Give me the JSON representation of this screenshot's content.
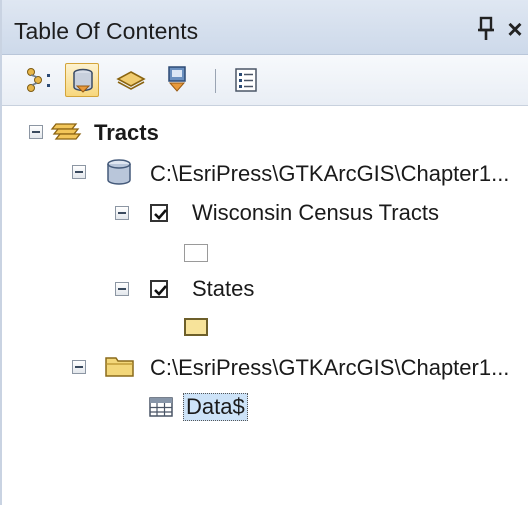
{
  "window": {
    "title": "Table Of Contents",
    "pin_glyph": "⊥",
    "close_glyph": "×"
  },
  "toolbar": {
    "buttons": [
      {
        "name": "list-by-drawing-order",
        "icon": "drawing-order-icon",
        "selected": false
      },
      {
        "name": "list-by-source",
        "icon": "source-icon",
        "selected": true
      },
      {
        "name": "list-by-visibility",
        "icon": "visibility-icon",
        "selected": false
      },
      {
        "name": "list-by-selection",
        "icon": "selection-icon",
        "selected": false
      },
      {
        "name": "options",
        "icon": "options-icon",
        "selected": false
      }
    ]
  },
  "tree": {
    "dataframe": {
      "label": "Tracts",
      "icon": "layers-stack-icon"
    },
    "sources": [
      {
        "path": "C:\\EsriPress\\GTKArcGIS\\Chapter1...",
        "icon": "database-icon",
        "layers": [
          {
            "label": "Wisconsin Census Tracts",
            "checked": true,
            "swatch_fill": "#ffffff",
            "swatch_border": "#9a9a9a"
          },
          {
            "label": "States",
            "checked": true,
            "swatch_fill": "#f7e39a",
            "swatch_border": "#6d5f2a"
          }
        ]
      },
      {
        "path": "C:\\EsriPress\\GTKArcGIS\\Chapter1...",
        "icon": "folder-icon",
        "tables": [
          {
            "label": "Data$",
            "icon": "table-icon",
            "selected": true
          }
        ]
      }
    ]
  },
  "colors": {
    "titlebar": "#d5dfee",
    "selection_highlight": "#cde3f8",
    "toolbar_selected": "#f7d77d"
  }
}
